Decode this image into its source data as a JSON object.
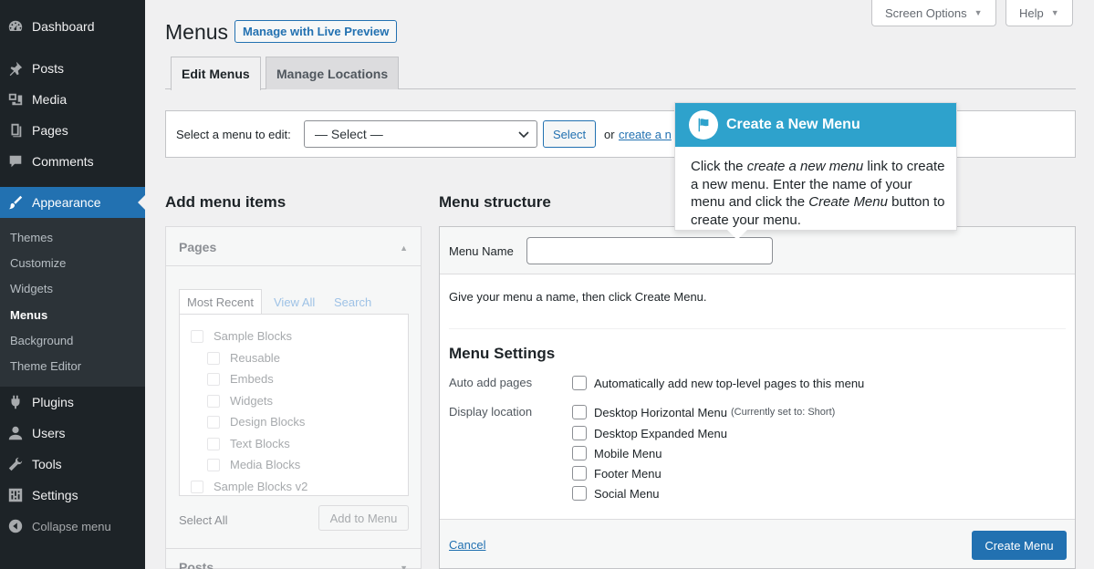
{
  "sidebar": {
    "items": [
      {
        "label": "Dashboard",
        "icon": "dashboard-icon"
      },
      {
        "label": "Posts",
        "icon": "pin-icon"
      },
      {
        "label": "Media",
        "icon": "media-icon"
      },
      {
        "label": "Pages",
        "icon": "page-icon"
      },
      {
        "label": "Comments",
        "icon": "comment-icon"
      },
      {
        "label": "Appearance",
        "icon": "brush-icon"
      },
      {
        "label": "Plugins",
        "icon": "plug-icon"
      },
      {
        "label": "Users",
        "icon": "user-icon"
      },
      {
        "label": "Tools",
        "icon": "wrench-icon"
      },
      {
        "label": "Settings",
        "icon": "settings-icon"
      }
    ],
    "submenu": [
      "Themes",
      "Customize",
      "Widgets",
      "Menus",
      "Background",
      "Theme Editor"
    ],
    "collapse_label": "Collapse menu"
  },
  "top_tabs": {
    "screen_options": "Screen Options",
    "help": "Help"
  },
  "header": {
    "title": "Menus",
    "live_preview": "Manage with Live Preview"
  },
  "nav_tabs": [
    "Edit Menus",
    "Manage Locations"
  ],
  "manage_menus": {
    "label": "Select a menu to edit:",
    "selected": "— Select —",
    "select_button": "Select",
    "or_text": "or",
    "create_link": "create a n"
  },
  "left_column": {
    "heading": "Add menu items",
    "pages_title": "Pages",
    "tabs": [
      "Most Recent",
      "View All",
      "Search"
    ],
    "items": [
      "Sample Blocks",
      "Reusable",
      "Embeds",
      "Widgets",
      "Design Blocks",
      "Text Blocks",
      "Media Blocks",
      "Sample Blocks v2"
    ],
    "select_all": "Select All",
    "add_to_menu": "Add to Menu",
    "posts_title": "Posts"
  },
  "right_column": {
    "heading": "Menu structure",
    "menu_name_label": "Menu Name",
    "menu_name_value": "",
    "instructions": "Give your menu a name, then click Create Menu.",
    "settings_title": "Menu Settings",
    "auto_add_label": "Auto add pages",
    "auto_add_option": "Automatically add new top-level pages to this menu",
    "display_location_label": "Display location",
    "locations": [
      {
        "label": "Desktop Horizontal Menu",
        "note": "(Currently set to: Short)"
      },
      {
        "label": "Desktop Expanded Menu",
        "note": ""
      },
      {
        "label": "Mobile Menu",
        "note": ""
      },
      {
        "label": "Footer Menu",
        "note": ""
      },
      {
        "label": "Social Menu",
        "note": ""
      }
    ],
    "cancel": "Cancel",
    "create_menu": "Create Menu"
  },
  "pointer": {
    "title": "Create a New Menu",
    "body_1": "Click the ",
    "body_em_1": "create a new menu",
    "body_2": " link to create a new menu. Enter the name of your menu and click the ",
    "body_em_2": "Create Menu",
    "body_3": " button to create your menu."
  },
  "colors": {
    "sidebar_bg": "#1d2327",
    "accent": "#2271b1",
    "pointer_header": "#2ea2cc"
  }
}
